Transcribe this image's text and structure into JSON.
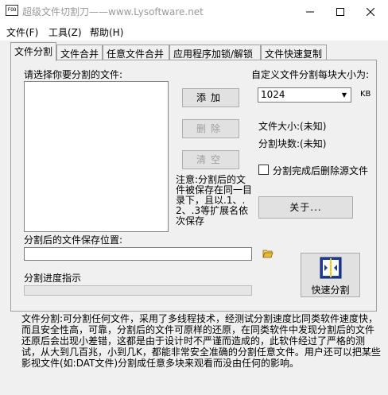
{
  "window": {
    "icon_text": "FOO",
    "title": "超级文件切割刀——www.Lysoftware.net"
  },
  "menu": [
    {
      "label": "文件(F)"
    },
    {
      "label": "工具(Z)"
    },
    {
      "label": "帮助(H)"
    }
  ],
  "tabs": [
    {
      "label": "文件分割",
      "active": true
    },
    {
      "label": "文件合并"
    },
    {
      "label": "任意文件合并"
    },
    {
      "label": "应用程序加锁/解锁"
    },
    {
      "label": "文件快速复制"
    }
  ],
  "split": {
    "select_label": "请选择你要分割的文件:",
    "add_button": "添加",
    "delete_button": "删除",
    "clear_button": "清空",
    "size_label": "自定义文件分割每块大小为:",
    "size_value": "1024",
    "size_unit": "KB",
    "file_size": "文件大小:(未知)",
    "block_count": "分割块数:(未知)",
    "delete_source_label": "分割完成后删除源文件",
    "note": "注意:分割后的文件被保存在同一目录下，且以.1、.2、.3等扩展名依次保存",
    "about_button": "关于...",
    "save_location_label": "分割后的文件保存位置:",
    "save_location_value": "",
    "progress_label": "分割进度指示",
    "progress_value": 0,
    "quick_split_button": "快速分割"
  },
  "description": "文件分割:可分割任何文件，采用了多线程技术，经测试分割速度比同类软件速度快，而且安全性高，可靠，分割后的文件可原样的还原，在同类软件中发现分割后的文件还原后会出现小差错，这都是由于设计时不严谨而造成的，此软件经过了严格的测试，从大到几百兆，小到几K，都能非常安全准确的分割任意文件。用户还可以把某些影视文件(如:DAT文件)分割成任意多块来观看而没由任何的影响。",
  "colors": {
    "window_bg": "#f0f0f0",
    "title_text": "#999999",
    "disabled_text": "#a0a0a0"
  }
}
